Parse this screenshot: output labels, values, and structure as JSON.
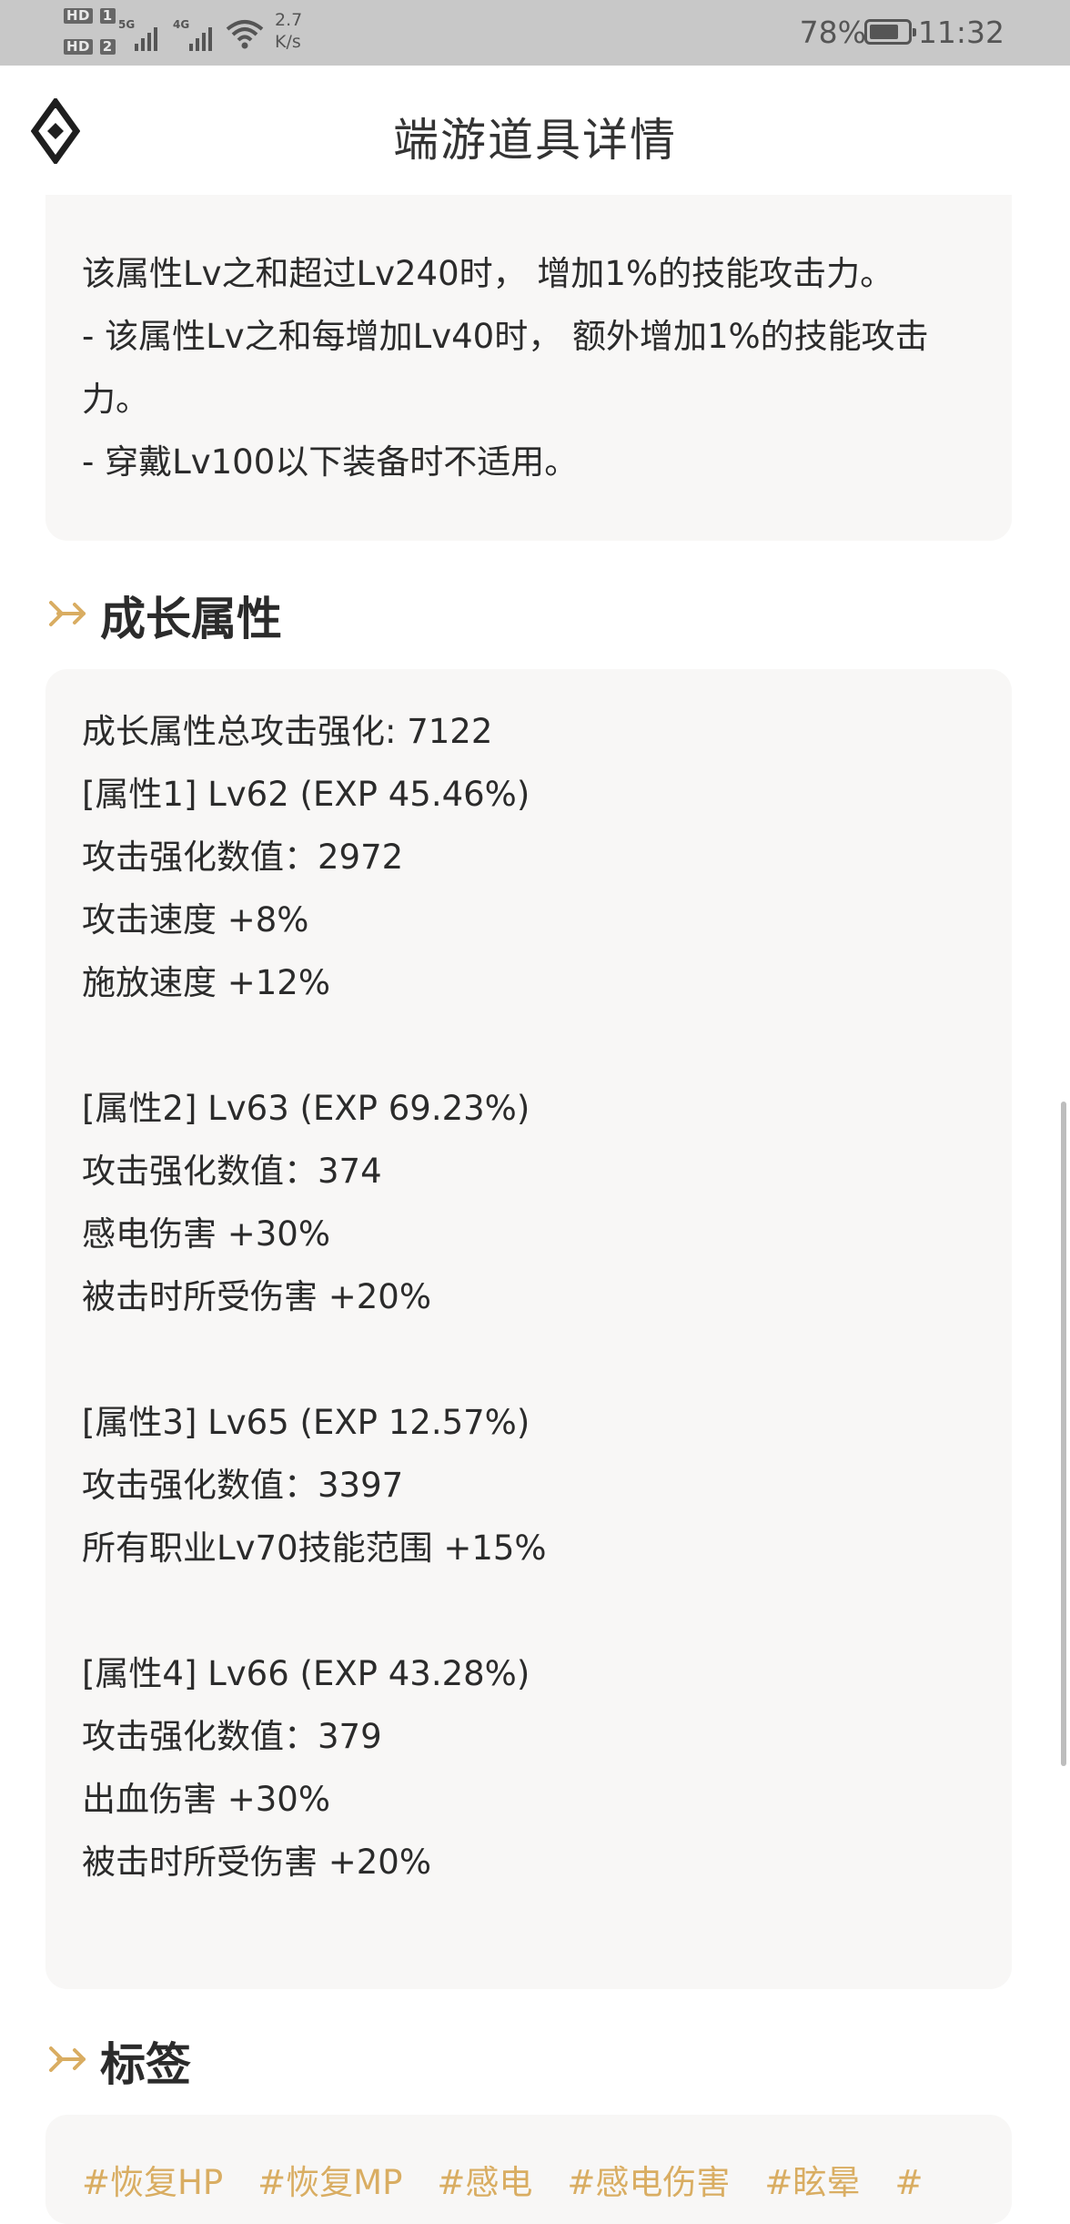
{
  "status_bar": {
    "hd1": "HD",
    "hd1_num": "1",
    "hd2": "HD",
    "hd2_num": "2",
    "net1": "5G",
    "net2": "4G",
    "speed_value": "2.7",
    "speed_unit": "K/s",
    "battery_pct": "78%",
    "battery_level": 0.78,
    "time": "11:32"
  },
  "header": {
    "title": "端游道具详情",
    "logo_icon": "diamond-logo-icon"
  },
  "top_card": {
    "text": "该属性Lv之和超过Lv240时， 增加1%的技能攻击力。\n- 该属性Lv之和每增加Lv40时， 额外增加1%的技能攻击力。\n- 穿戴Lv100以下装备时不适用。"
  },
  "growth_section": {
    "title": "成长属性",
    "lines": [
      "成长属性总攻击强化: 7122",
      "[属性1] Lv62 (EXP 45.46%)",
      "攻击强化数值：2972",
      "攻击速度 +8%",
      "施放速度 +12%",
      "",
      "[属性2] Lv63 (EXP 69.23%)",
      "攻击强化数值：374",
      "感电伤害 +30%",
      "被击时所受伤害 +20%",
      "",
      "[属性3] Lv65 (EXP 12.57%)",
      "攻击强化数值：3397",
      "所有职业Lv70技能范围 +15%",
      "",
      "[属性4] Lv66 (EXP 43.28%)",
      "攻击强化数值：379",
      "出血伤害 +30%",
      "被击时所受伤害 +20%"
    ]
  },
  "tags_section": {
    "title": "标签",
    "tags": [
      "#恢复HP",
      "#恢复MP",
      "#感电",
      "#感电伤害",
      "#眩晕",
      "#"
    ]
  },
  "colors": {
    "accent": "#d9ad62",
    "status_bar_bg": "#c8c8c8",
    "card_bg": "#f8f7f6"
  }
}
